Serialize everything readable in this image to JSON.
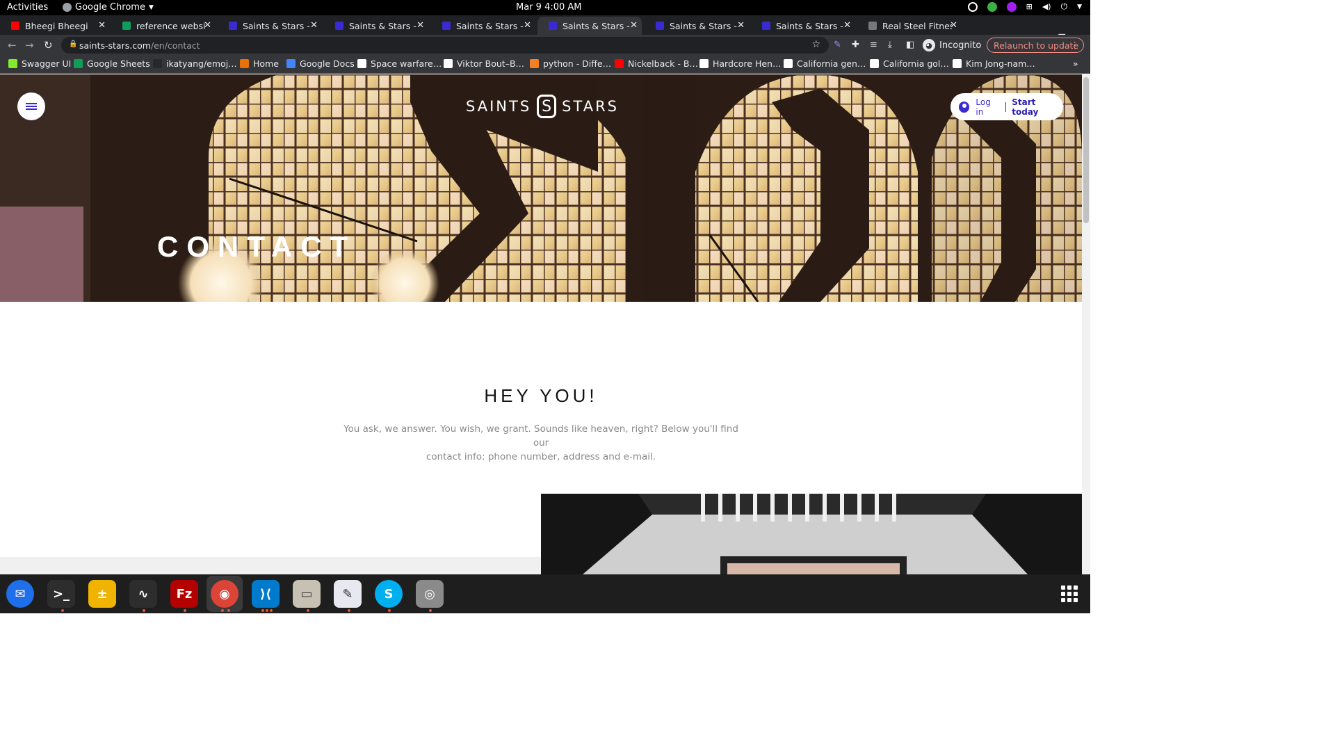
{
  "system_bar": {
    "activities": "Activities",
    "app_name": "Google Chrome",
    "clock": "Mar 9  4:00 AM"
  },
  "browser": {
    "tabs": [
      {
        "title": "Bheegi Bheegi",
        "favicon_color": "#ff0000"
      },
      {
        "title": "reference website",
        "favicon_color": "#0f9d58"
      },
      {
        "title": "Saints & Stars - Ab",
        "favicon_color": "#3a2bd0"
      },
      {
        "title": "Saints & Stars - Tra",
        "favicon_color": "#3a2bd0"
      },
      {
        "title": "Saints & Stars - Sai",
        "favicon_color": "#3a2bd0"
      },
      {
        "title": "Saints & Stars - CO",
        "favicon_color": "#3a2bd0",
        "active": true
      },
      {
        "title": "Saints & Stars - FA",
        "favicon_color": "#3a2bd0"
      },
      {
        "title": "Saints & Stars - Sai",
        "favicon_color": "#3a2bd0"
      },
      {
        "title": "Real Steel Fitness",
        "favicon_color": "#777777"
      }
    ],
    "url_host": "saints-stars.com",
    "url_path": "/en/contact",
    "incognito_label": "Incognito",
    "relaunch_label": "Relaunch to update",
    "bookmarks": [
      {
        "label": "Swagger UI",
        "icon": "swagger-icon",
        "color": "#85ea2d"
      },
      {
        "label": "Google Sheets",
        "icon": "sheets-icon",
        "color": "#0f9d58"
      },
      {
        "label": "ikatyang/emoj…",
        "icon": "github-icon",
        "color": "#24292e"
      },
      {
        "label": "Home",
        "icon": "home-icon",
        "color": "#e8710a"
      },
      {
        "label": "Google Docs",
        "icon": "docs-icon",
        "color": "#4285f4"
      },
      {
        "label": "Space warfare…",
        "icon": "wikipedia-icon",
        "color": "#ffffff"
      },
      {
        "label": "Viktor Bout–B…",
        "icon": "wikipedia-icon",
        "color": "#ffffff"
      },
      {
        "label": "python - Diffe…",
        "icon": "stackoverflow-icon",
        "color": "#f48024"
      },
      {
        "label": "Nickelback - B…",
        "icon": "youtube-icon",
        "color": "#ff0000"
      },
      {
        "label": "Hardcore Hen…",
        "icon": "wikipedia-icon",
        "color": "#ffffff"
      },
      {
        "label": "California gen…",
        "icon": "wikipedia-icon",
        "color": "#ffffff"
      },
      {
        "label": "California gol…",
        "icon": "wikipedia-icon",
        "color": "#ffffff"
      },
      {
        "label": "Kim Jong-nam…",
        "icon": "wikipedia-icon",
        "color": "#ffffff"
      }
    ]
  },
  "site": {
    "logo_left": "SAINTS",
    "logo_mark": "S",
    "logo_right": "STARS",
    "login_label": "Log in",
    "start_label": "Start today",
    "brand_color": "#3a2bd0",
    "hero_title": "CONTACT",
    "section_title": "HEY YOU!",
    "intro_line1": "You ask, we answer. You wish, we grant. Sounds like heaven, right? Below you'll find our",
    "intro_line2": "contact info: phone number, address and e-mail."
  },
  "dock": {
    "apps": [
      {
        "name": "thunderbird",
        "color": "#1f6feb",
        "glyph": "✉"
      },
      {
        "name": "terminal",
        "color": "#2d2d2d",
        "glyph": ">_"
      },
      {
        "name": "calculator",
        "color": "#f0b400",
        "glyph": "±"
      },
      {
        "name": "system-monitor",
        "color": "#2d2d2d",
        "glyph": "∿"
      },
      {
        "name": "filezilla",
        "color": "#b30000",
        "glyph": "Fz"
      },
      {
        "name": "chrome",
        "color": "#db4437",
        "glyph": "◉"
      },
      {
        "name": "vscode",
        "color": "#007acc",
        "glyph": "⟩⟨"
      },
      {
        "name": "files",
        "color": "#c7c1b3",
        "glyph": "▭"
      },
      {
        "name": "text-editor",
        "color": "#e8e8f0",
        "glyph": "✎"
      },
      {
        "name": "skype",
        "color": "#00aff0",
        "glyph": "S"
      },
      {
        "name": "disc",
        "color": "#8a8a8a",
        "glyph": "◎"
      }
    ]
  }
}
